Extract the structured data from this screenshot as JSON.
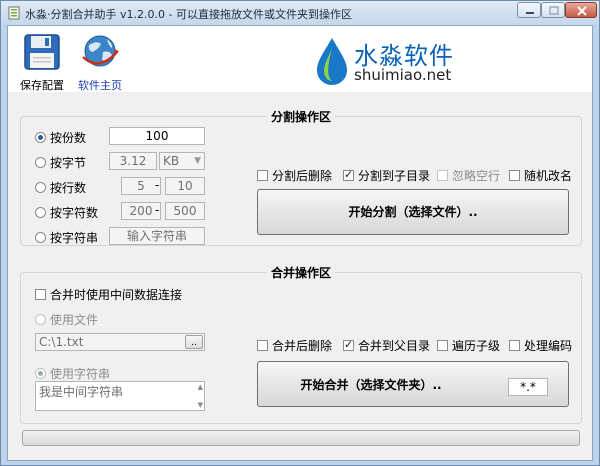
{
  "window": {
    "title": "水淼·分割合并助手 v1.2.0.0 - 可以直接拖放文件或文件夹到操作区"
  },
  "header": {
    "save_label": "保存配置",
    "home_label": "软件主页",
    "logo_cn": "水淼软件",
    "logo_en": "shuimiao.net",
    "brand_color": "#0a62b8"
  },
  "split": {
    "title": "分割操作区",
    "by_count_label": "按份数",
    "count_value": "100",
    "by_bytes_label": "按字节",
    "bytes_value": "3.12",
    "bytes_unit": "KB",
    "by_lines_label": "按行数",
    "lines_from": "5",
    "lines_to": "10",
    "by_chars_label": "按字符数",
    "chars_from": "200",
    "chars_to": "500",
    "by_string_label": "按字符串",
    "string_placeholder": "输入字符串",
    "range_sep": "-",
    "delete_after_label": "分割后删除",
    "to_subdir_label": "分割到子目录",
    "ignore_blank_label": "忽略空行",
    "random_rename_label": "随机改名",
    "start_button": "开始分割（选择文件）.."
  },
  "merge": {
    "title": "合并操作区",
    "use_intermediate_label": "合并时使用中间数据连接",
    "use_file_label": "使用文件",
    "file_path": "C:\\1.txt",
    "browse_label": "..",
    "use_string_label": "使用字符串",
    "string_value": "我是中间字符串",
    "delete_after_label": "合并后删除",
    "to_parent_label": "合并到父目录",
    "traverse_sub_label": "遍历子级",
    "handle_encoding_label": "处理编码",
    "start_button": "开始合并（选择文件夹）..",
    "filter_value": "*.*"
  },
  "progress": {
    "value": 0
  }
}
